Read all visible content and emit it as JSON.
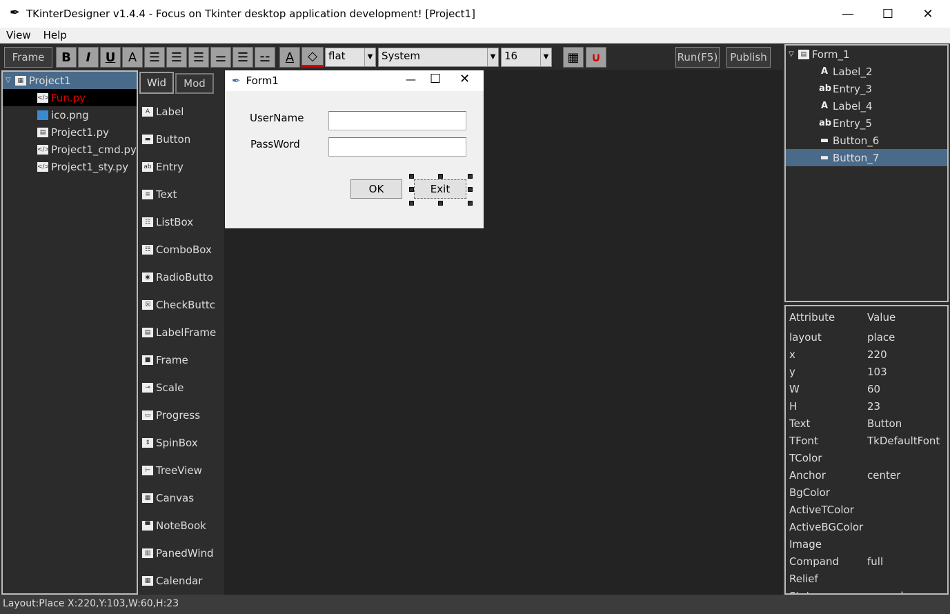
{
  "window": {
    "title": "TKinterDesigner v1.4.4 - Focus on Tkinter desktop application development!    [Project1]"
  },
  "menu": [
    "View",
    "Help"
  ],
  "toolbar": {
    "frame": "Frame",
    "bold": "B",
    "italic": "I",
    "underline": "U",
    "font": "A",
    "text_color": "A",
    "relief": "flat",
    "font_family": "System",
    "font_size": "16",
    "run": "Run(F5)",
    "publish": "Publish",
    "accent_fill": "#d00000"
  },
  "project_tree": {
    "root": "Project1",
    "files": [
      {
        "name": "Fun.py",
        "icon": "code-icon",
        "selected": true
      },
      {
        "name": "ico.png",
        "icon": "image-icon"
      },
      {
        "name": "Project1.py",
        "icon": "code-icon"
      },
      {
        "name": "Project1_cmd.py",
        "icon": "code-icon"
      },
      {
        "name": "Project1_sty.py",
        "icon": "code-icon"
      }
    ]
  },
  "palette": {
    "tabs": [
      "Wid",
      "Mod"
    ],
    "items": [
      {
        "label": "Label",
        "icon": "A"
      },
      {
        "label": "Button",
        "icon": "▬"
      },
      {
        "label": "Entry",
        "icon": "ab"
      },
      {
        "label": "Text",
        "icon": "≡"
      },
      {
        "label": "ListBox",
        "icon": "☷"
      },
      {
        "label": "ComboBox",
        "icon": "☷"
      },
      {
        "label": "RadioButto",
        "icon": "◉"
      },
      {
        "label": "CheckButtc",
        "icon": "☒"
      },
      {
        "label": "LabelFrame",
        "icon": "▤"
      },
      {
        "label": "Frame",
        "icon": "■"
      },
      {
        "label": "Scale",
        "icon": "⊸"
      },
      {
        "label": "Progress",
        "icon": "▭"
      },
      {
        "label": "SpinBox",
        "icon": "⇕"
      },
      {
        "label": "TreeView",
        "icon": "⊢"
      },
      {
        "label": "Canvas",
        "icon": "▦"
      },
      {
        "label": "NoteBook",
        "icon": "▀"
      },
      {
        "label": "PanedWind",
        "icon": "▥"
      },
      {
        "label": "Calendar",
        "icon": "▦"
      }
    ]
  },
  "form": {
    "title": "Form1",
    "username_label": "UserName",
    "password_label": "PassWord",
    "ok": "OK",
    "exit": "Exit"
  },
  "widget_tree": {
    "root": "Form_1",
    "items": [
      {
        "label": "Label_2",
        "icon": "A"
      },
      {
        "label": "Entry_3",
        "icon": "ab"
      },
      {
        "label": "Label_4",
        "icon": "A"
      },
      {
        "label": "Entry_5",
        "icon": "ab"
      },
      {
        "label": "Button_6",
        "icon": "▬"
      },
      {
        "label": "Button_7",
        "icon": "▬",
        "selected": true
      }
    ]
  },
  "properties": {
    "header": [
      "Attribute",
      "Value"
    ],
    "rows": [
      [
        "layout",
        "place"
      ],
      [
        "x",
        "220"
      ],
      [
        "y",
        "103"
      ],
      [
        "W",
        "60"
      ],
      [
        "H",
        "23"
      ],
      [
        "Text",
        "Button"
      ],
      [
        "TFont",
        "TkDefaultFont"
      ],
      [
        "TColor",
        ""
      ],
      [
        "Anchor",
        "center"
      ],
      [
        "BgColor",
        ""
      ],
      [
        "ActiveTColor",
        ""
      ],
      [
        "ActiveBGColor",
        ""
      ],
      [
        "Image",
        ""
      ],
      [
        "Compand",
        "full"
      ],
      [
        "Relief",
        ""
      ],
      [
        "State",
        "normal"
      ]
    ]
  },
  "status": "Layout:Place   X:220,Y:103,W:60,H:23"
}
